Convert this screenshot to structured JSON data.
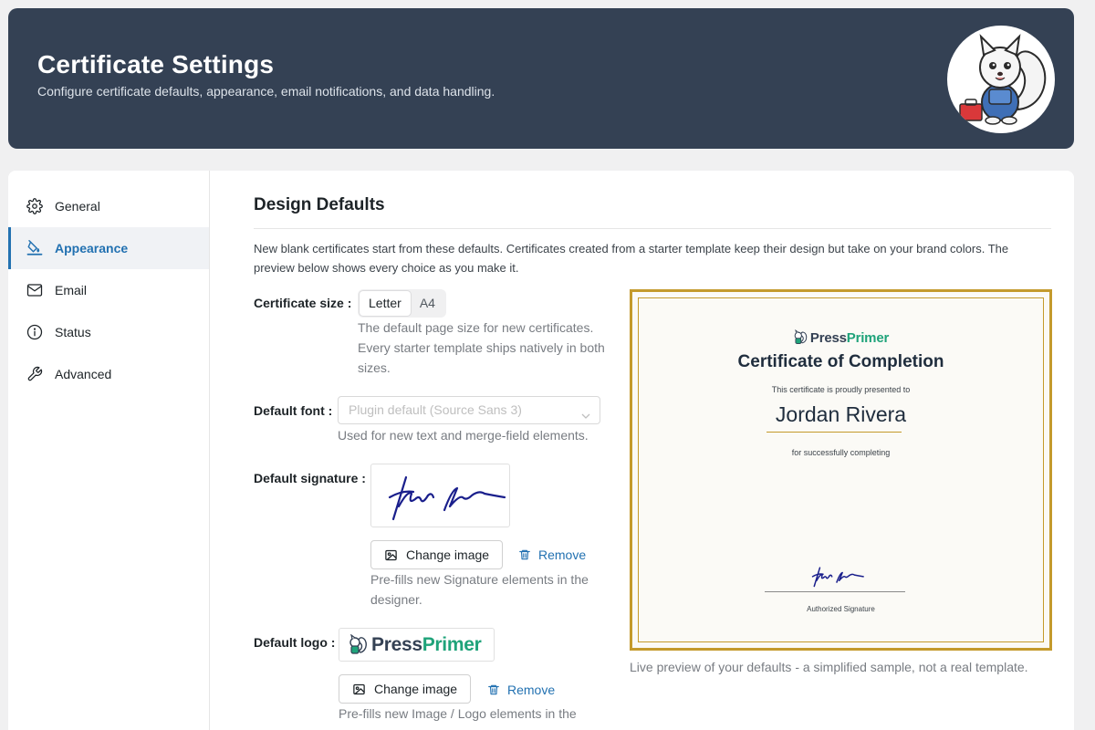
{
  "header": {
    "title": "Certificate Settings",
    "subtitle": "Configure certificate defaults, appearance, email notifications, and data handling."
  },
  "sidebar": {
    "items": [
      {
        "label": "General",
        "icon": "gear-icon"
      },
      {
        "label": "Appearance",
        "icon": "paint-bucket-icon",
        "active": true
      },
      {
        "label": "Email",
        "icon": "envelope-icon"
      },
      {
        "label": "Status",
        "icon": "info-icon"
      },
      {
        "label": "Advanced",
        "icon": "wrench-icon"
      }
    ]
  },
  "main": {
    "section_title": "Design Defaults",
    "intro": "New blank certificates start from these defaults. Certificates created from a starter template keep their design but take on your brand colors. The preview below shows every choice as you make it.",
    "size": {
      "label": "Certificate size",
      "options": [
        "Letter",
        "A4"
      ],
      "selected": "Letter",
      "help": "The default page size for new certificates. Every starter template ships natively in both sizes."
    },
    "font": {
      "label": "Default font",
      "placeholder": "Plugin default (Source Sans 3)",
      "help": "Used for new text and merge-field elements."
    },
    "signature": {
      "label": "Default signature",
      "change_label": "Change image",
      "remove_label": "Remove",
      "help": "Pre-fills new Signature elements in the designer."
    },
    "logo": {
      "label": "Default logo",
      "logo_text_a": "Press",
      "logo_text_b": "Primer",
      "change_label": "Change image",
      "remove_label": "Remove",
      "help": "Pre-fills new Image / Logo elements in the"
    }
  },
  "preview": {
    "logo_text_a": "Press",
    "logo_text_b": "Primer",
    "title": "Certificate of Completion",
    "presented": "This certificate is proudly presented to",
    "name": "Jordan Rivera",
    "completing": "for successfully completing",
    "signature_caption": "Authorized Signature",
    "caption": "Live preview of your defaults - a simplified sample, not a real template.",
    "border_color": "#c49a2c"
  },
  "colors": {
    "header_bg": "#344154",
    "accent": "#2271b1",
    "brand_green": "#1fa37a"
  }
}
